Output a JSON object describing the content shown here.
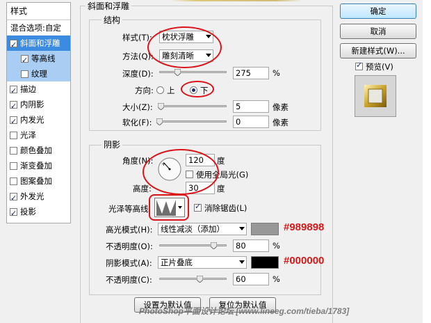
{
  "left_panel": {
    "header": "样式",
    "blend_label": "混合选项:自定",
    "items": [
      {
        "label": "斜面和浮雕",
        "checked": true,
        "state": "selected",
        "indent": false
      },
      {
        "label": "等高线",
        "checked": true,
        "state": "subselected",
        "indent": true
      },
      {
        "label": "纹理",
        "checked": false,
        "state": "subselected",
        "indent": true
      },
      {
        "label": "描边",
        "checked": true,
        "state": "normal",
        "indent": false
      },
      {
        "label": "内阴影",
        "checked": true,
        "state": "normal",
        "indent": false
      },
      {
        "label": "内发光",
        "checked": true,
        "state": "normal",
        "indent": false
      },
      {
        "label": "光泽",
        "checked": false,
        "state": "normal",
        "indent": false
      },
      {
        "label": "颜色叠加",
        "checked": false,
        "state": "normal",
        "indent": false
      },
      {
        "label": "渐变叠加",
        "checked": false,
        "state": "normal",
        "indent": false
      },
      {
        "label": "图案叠加",
        "checked": false,
        "state": "normal",
        "indent": false
      },
      {
        "label": "外发光",
        "checked": true,
        "state": "normal",
        "indent": false
      },
      {
        "label": "投影",
        "checked": true,
        "state": "normal",
        "indent": false
      }
    ]
  },
  "panel": {
    "title": "斜面和浮雕",
    "structure": {
      "title": "结构",
      "style_label": "样式(T):",
      "style_value": "枕状浮雕",
      "method_label": "方法(Q):",
      "method_value": "雕刻清晰",
      "depth_label": "深度(D):",
      "depth_value": "275",
      "depth_unit": "%",
      "depth_level": 0.27,
      "direction_label": "方向:",
      "direction_up": "上",
      "direction_down": "下",
      "size_label": "大小(Z):",
      "size_value": "5",
      "size_unit": "像素",
      "size_level": 0.02,
      "soften_label": "软化(F):",
      "soften_value": "0",
      "soften_unit": "像素",
      "soften_level": 0.0
    },
    "shading": {
      "title": "阴影",
      "angle_label": "角度(N):",
      "angle_value": "120",
      "angle_unit": "度",
      "global_light_label": "使用全局光(G)",
      "altitude_label": "高度:",
      "altitude_value": "30",
      "altitude_unit": "度",
      "gloss_label": "光泽等高线:",
      "antialias_label": "消除锯齿(L)",
      "highlight_mode_label": "高光模式(H):",
      "highlight_mode_value": "线性减淡（添加）",
      "highlight_color": "#989898",
      "highlight_opacity_label": "不透明度(O):",
      "highlight_opacity_value": "80",
      "highlight_opacity_unit": "%",
      "highlight_opacity_level": 0.8,
      "shadow_mode_label": "阴影模式(A):",
      "shadow_mode_value": "正片叠底",
      "shadow_color": "#000000",
      "shadow_opacity_label": "不透明度(C):",
      "shadow_opacity_value": "60",
      "shadow_opacity_unit": "%",
      "shadow_opacity_level": 0.6
    },
    "set_default_button": "设置为默认值",
    "reset_default_button": "复位为默认值"
  },
  "annotations": {
    "highlight_hex": "#989898",
    "shadow_hex": "#000000"
  },
  "right_panel": {
    "ok_button": "确定",
    "cancel_button": "取消",
    "new_style_button": "新建样式(W)...",
    "preview_label": "预览(V)"
  },
  "watermark": "PhotoShop平面设计论坛 [www.lineeg.com/tieba/1783]",
  "colors": {
    "accent_selected": "#3b8be0",
    "annotation_red": "#d21a1a"
  }
}
